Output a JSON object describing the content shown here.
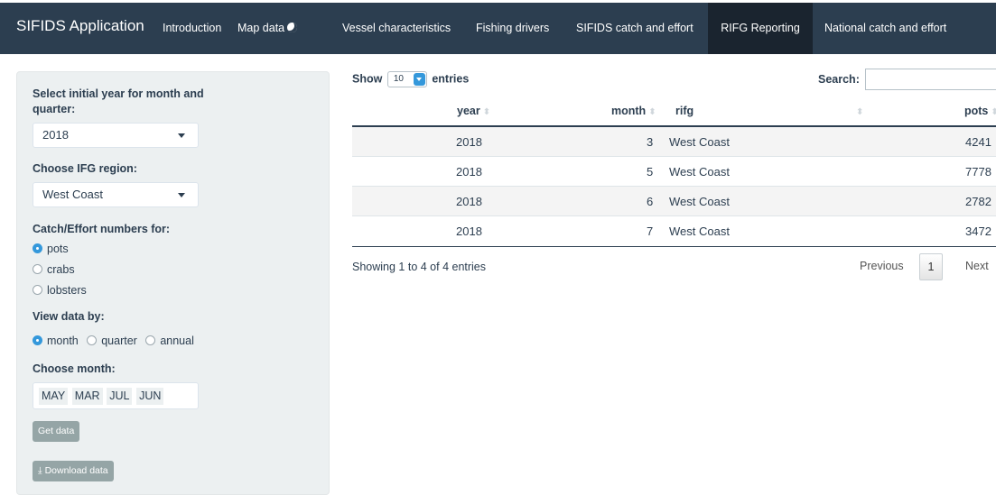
{
  "app": {
    "title": "SIFIDS Application"
  },
  "nav": {
    "introduction": "Introduction",
    "map_data": "Map data",
    "vessel": "Vessel characteristics",
    "fishing": "Fishing drivers",
    "sifids_catch": "SIFIDS catch and effort",
    "rifg": "RIFG Reporting",
    "national": "National catch and effort"
  },
  "sidebar": {
    "year_label": "Select initial year for month and quarter:",
    "year_value": "2018",
    "region_label": "Choose IFG region:",
    "region_value": "West Coast",
    "catch_label": "Catch/Effort numbers for:",
    "catch_options": [
      "pots",
      "crabs",
      "lobsters"
    ],
    "catch_selected": "pots",
    "view_label": "View data by:",
    "view_options": [
      "month",
      "quarter",
      "annual"
    ],
    "view_selected": "month",
    "month_label": "Choose month:",
    "months": [
      "MAY",
      "MAR",
      "JUL",
      "JUN"
    ],
    "get_data": "Get data",
    "download": "Download data"
  },
  "table": {
    "show": "Show",
    "page_length": "10",
    "entries": "entries",
    "search_label": "Search:",
    "search_value": "",
    "columns": [
      "year",
      "month",
      "rifg",
      "pots"
    ],
    "rows": [
      [
        "2018",
        "3",
        "West Coast",
        "4241"
      ],
      [
        "2018",
        "5",
        "West Coast",
        "7778"
      ],
      [
        "2018",
        "6",
        "West Coast",
        "2782"
      ],
      [
        "2018",
        "7",
        "West Coast",
        "3472"
      ]
    ],
    "info": "Showing 1 to 4 of 4 entries",
    "previous": "Previous",
    "page": "1",
    "next": "Next"
  },
  "colors": {
    "navbar": "#2c3e50",
    "nav_active": "#1a242f",
    "sidebar": "#ecf0f1",
    "accent": "#3498db",
    "button": "#95a5a6"
  }
}
